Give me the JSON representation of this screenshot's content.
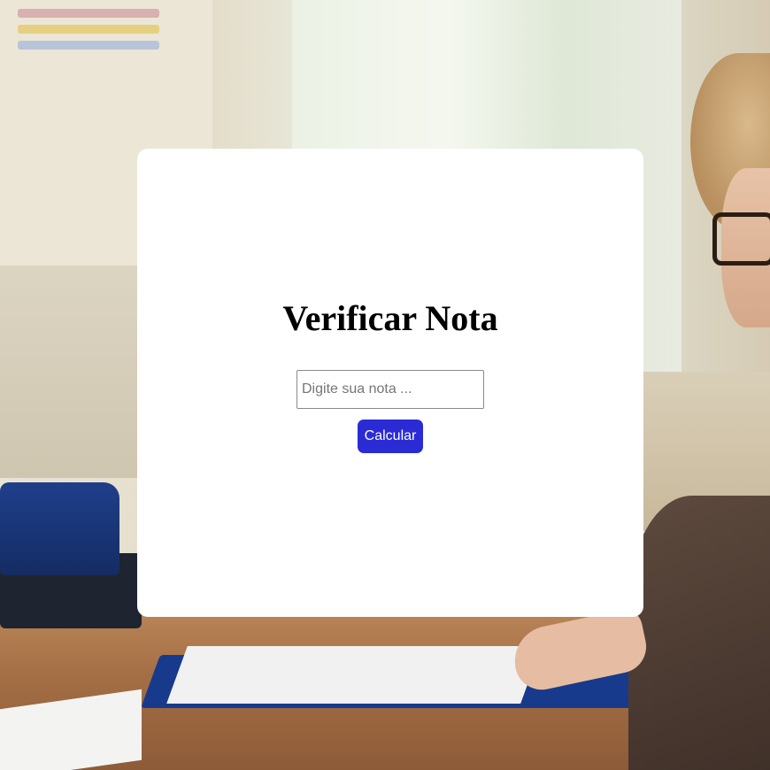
{
  "page": {
    "title": "Verificar Nota"
  },
  "form": {
    "nota_input": {
      "value": "",
      "placeholder": "Digite sua nota ..."
    },
    "calculate_label": "Calcular"
  },
  "colors": {
    "card_background": "#ffffff",
    "button_background": "#2b2bd6",
    "button_text": "#ffffff",
    "title_text": "#000000"
  }
}
